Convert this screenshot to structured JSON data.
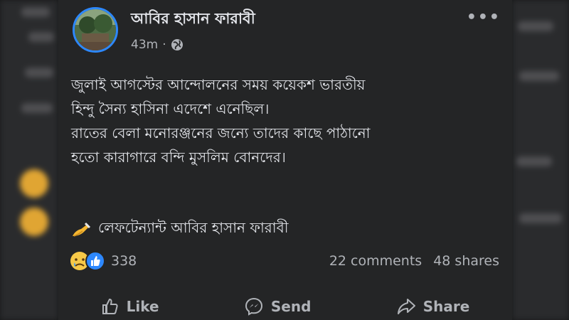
{
  "post": {
    "author": "আবির হাসান ফারাবী",
    "time": "43m",
    "privacy_icon": "globe-icon",
    "more_label": "•••",
    "lines": [
      "জুলাই আগস্টের আন্দোলনের সময় কয়েকশ ভারতীয়",
      "হিন্দু সৈন্য হাসিনা এদেশে এনেছিল।",
      " রাতের বেলা মনোরঞ্জনের জন্যে তাদের কাছে পাঠানো",
      "হতো কারাগারে বন্দি মুসলিম  বোনদের।"
    ],
    "signature_text": "লেফটেন্যান্ট আবির হাসান ফারাবী",
    "signature_icon": "writing-hand-icon"
  },
  "stats": {
    "reaction_count": "338",
    "comments": "22 comments",
    "shares": "48 shares"
  },
  "actions": {
    "like": "Like",
    "send": "Send",
    "share": "Share"
  },
  "colors": {
    "background": "#18191a",
    "card": "#242526",
    "text": "#e4e6eb",
    "muted": "#b0b3b8",
    "accent": "#2d88ff"
  }
}
